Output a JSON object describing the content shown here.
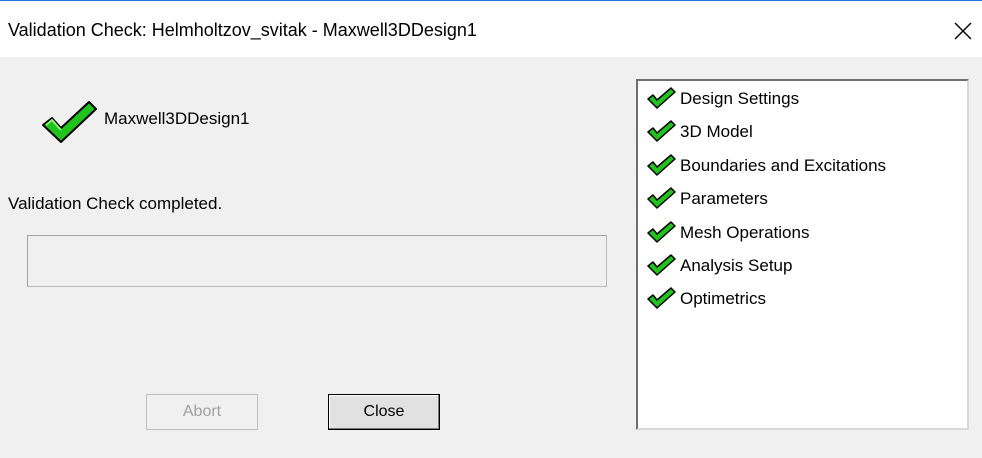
{
  "window": {
    "title": "Validation Check: Helmholtzov_svitak - Maxwell3DDesign1",
    "close_icon": "close-x-icon"
  },
  "design": {
    "name": "Maxwell3DDesign1",
    "icon": "green-checkmark-icon"
  },
  "status": {
    "message": "Validation Check completed.",
    "progress_percent": 0
  },
  "buttons": {
    "abort_label": "Abort",
    "abort_enabled": false,
    "close_label": "Close"
  },
  "checklist": {
    "items": [
      {
        "label": "Design Settings",
        "status_icon": "green-checkmark-icon"
      },
      {
        "label": "3D Model",
        "status_icon": "green-checkmark-icon"
      },
      {
        "label": "Boundaries and Excitations",
        "status_icon": "green-checkmark-icon"
      },
      {
        "label": "Parameters",
        "status_icon": "green-checkmark-icon"
      },
      {
        "label": "Mesh Operations",
        "status_icon": "green-checkmark-icon"
      },
      {
        "label": "Analysis Setup",
        "status_icon": "green-checkmark-icon"
      },
      {
        "label": "Optimetrics",
        "status_icon": "green-checkmark-icon"
      }
    ]
  },
  "colors": {
    "check_green": "#22c21c",
    "check_outline": "#000000",
    "window_accent": "#1e7ad8"
  }
}
